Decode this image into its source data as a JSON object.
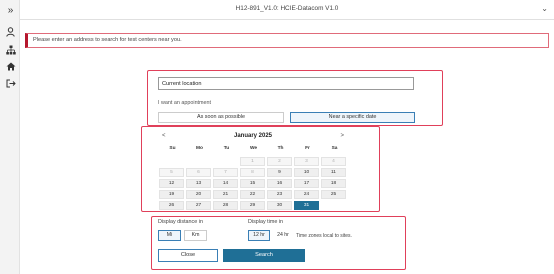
{
  "header": {
    "title": "H12-891_V1.0: HCIE-Datacom V1.0"
  },
  "rail": {
    "icons": [
      "user-icon",
      "sitemap-icon",
      "home-icon",
      "logout-icon"
    ]
  },
  "notice": {
    "text": "Please enter an address to search for test centers near you."
  },
  "location": {
    "value": "Current location",
    "appointment_label": "I want an appointment",
    "soon_label": "As soon as possible",
    "near_label": "Near a specific date",
    "near_selected": true
  },
  "calendar": {
    "prev": "<",
    "next": ">",
    "month": "January 2025",
    "weekdays": [
      "Su",
      "Mo",
      "Tu",
      "We",
      "Th",
      "Fr",
      "Sa"
    ],
    "weeks": [
      [
        "",
        "",
        "",
        "1",
        "2",
        "3",
        "4"
      ],
      [
        "5",
        "6",
        "7",
        "8",
        "9",
        "10",
        "11"
      ],
      [
        "12",
        "13",
        "14",
        "15",
        "16",
        "17",
        "18"
      ],
      [
        "19",
        "20",
        "21",
        "22",
        "23",
        "24",
        "25"
      ],
      [
        "26",
        "27",
        "28",
        "29",
        "30",
        "31",
        ""
      ]
    ],
    "disabled_days": [
      "1",
      "2",
      "3",
      "4",
      "5",
      "6",
      "7",
      "8"
    ],
    "selected_day": "31"
  },
  "display": {
    "distance_label": "Display distance in",
    "mi_label": "Mi",
    "km_label": "Km",
    "time_label": "Display time in",
    "h12_label": "12 hr",
    "h24_label": "24 hr",
    "timezone_note": "Time zones local to sites.",
    "close_label": "Close",
    "search_label": "Search"
  },
  "colors": {
    "accent": "#1f6f96",
    "alert": "#b5172d",
    "highlight_outline": "#e0405a"
  }
}
